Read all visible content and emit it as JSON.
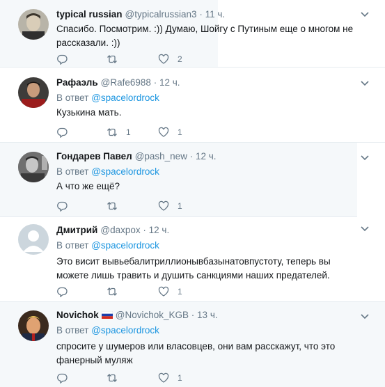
{
  "tweets": [
    {
      "name": "typical russian",
      "handle": "@typicalrussian3",
      "dot": "·",
      "time": "11 ч.",
      "reply_prefix": "",
      "reply_mention": "",
      "text": "Спасибо. Посмотрим. :)) Думаю, Шойгу с Путиным еще о многом не рассказали. :))",
      "reply_count": "",
      "retweet_count": "",
      "like_count": "2"
    },
    {
      "name": "Рафаэль",
      "handle": "@Rafe6988",
      "dot": "·",
      "time": "12 ч.",
      "reply_prefix": "В ответ",
      "reply_mention": "@spacelordrock",
      "text": "Кузькина мать.",
      "reply_count": "",
      "retweet_count": "1",
      "like_count": "1"
    },
    {
      "name": "Гондарев Павел",
      "handle": "@pash_new",
      "dot": "·",
      "time": "12 ч.",
      "reply_prefix": "В ответ",
      "reply_mention": "@spacelordrock",
      "text": "А что же ещё?",
      "reply_count": "",
      "retweet_count": "",
      "like_count": "1"
    },
    {
      "name": "Дмитрий",
      "handle": "@daxpox",
      "dot": "·",
      "time": "12 ч.",
      "reply_prefix": "В ответ",
      "reply_mention": "@spacelordrock",
      "text": "Это висит вывьебалитриллионывбазынатовпустоту, теперь вы можете лишь травить и душить санкциями наших предателей.",
      "reply_count": "",
      "retweet_count": "",
      "like_count": "1"
    },
    {
      "name": "Novichok",
      "handle": "@Novichok_KGB",
      "dot": "·",
      "time": "13 ч.",
      "reply_prefix": "В ответ",
      "reply_mention": "@spacelordrock",
      "text": "спросите у шумеров или власовцев, они вам расскажут, что это фанерный муляж",
      "reply_count": "",
      "retweet_count": "",
      "like_count": "1"
    }
  ],
  "colors": {
    "link": "#1b95e0",
    "muted": "#657786",
    "text": "#14171a",
    "tint": "#f5f8fa",
    "border": "#e6ecf0"
  },
  "icons": {
    "reply": "reply-icon",
    "retweet": "retweet-icon",
    "like": "heart-icon",
    "menu": "chevron-down-icon",
    "flag": "russian-flag-icon"
  }
}
